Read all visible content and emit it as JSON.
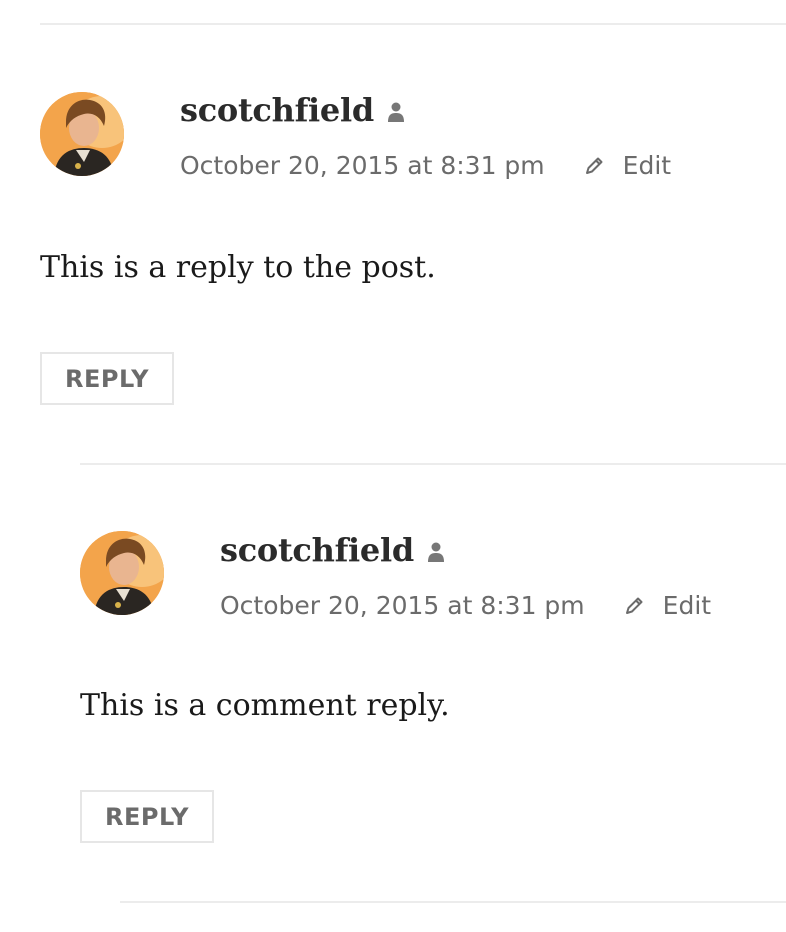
{
  "comments": [
    {
      "author": "scotchfield",
      "date": "October 20, 2015 at 8:31 pm",
      "edit_label": "Edit",
      "text": "This is a reply to the post.",
      "reply_label": "REPLY"
    },
    {
      "author": "scotchfield",
      "date": "October 20, 2015 at 8:31 pm",
      "edit_label": "Edit",
      "text": "This is a comment reply.",
      "reply_label": "REPLY"
    }
  ],
  "icons": {
    "author": "person-icon",
    "edit": "pencil-icon"
  },
  "colors": {
    "author_text": "#2b2b2b",
    "meta_text": "#6b6b6b",
    "body_text": "#1a1a1a",
    "divider": "#ececec",
    "button_border": "#e6e6e6",
    "avatar_background": "#f3a44b"
  }
}
